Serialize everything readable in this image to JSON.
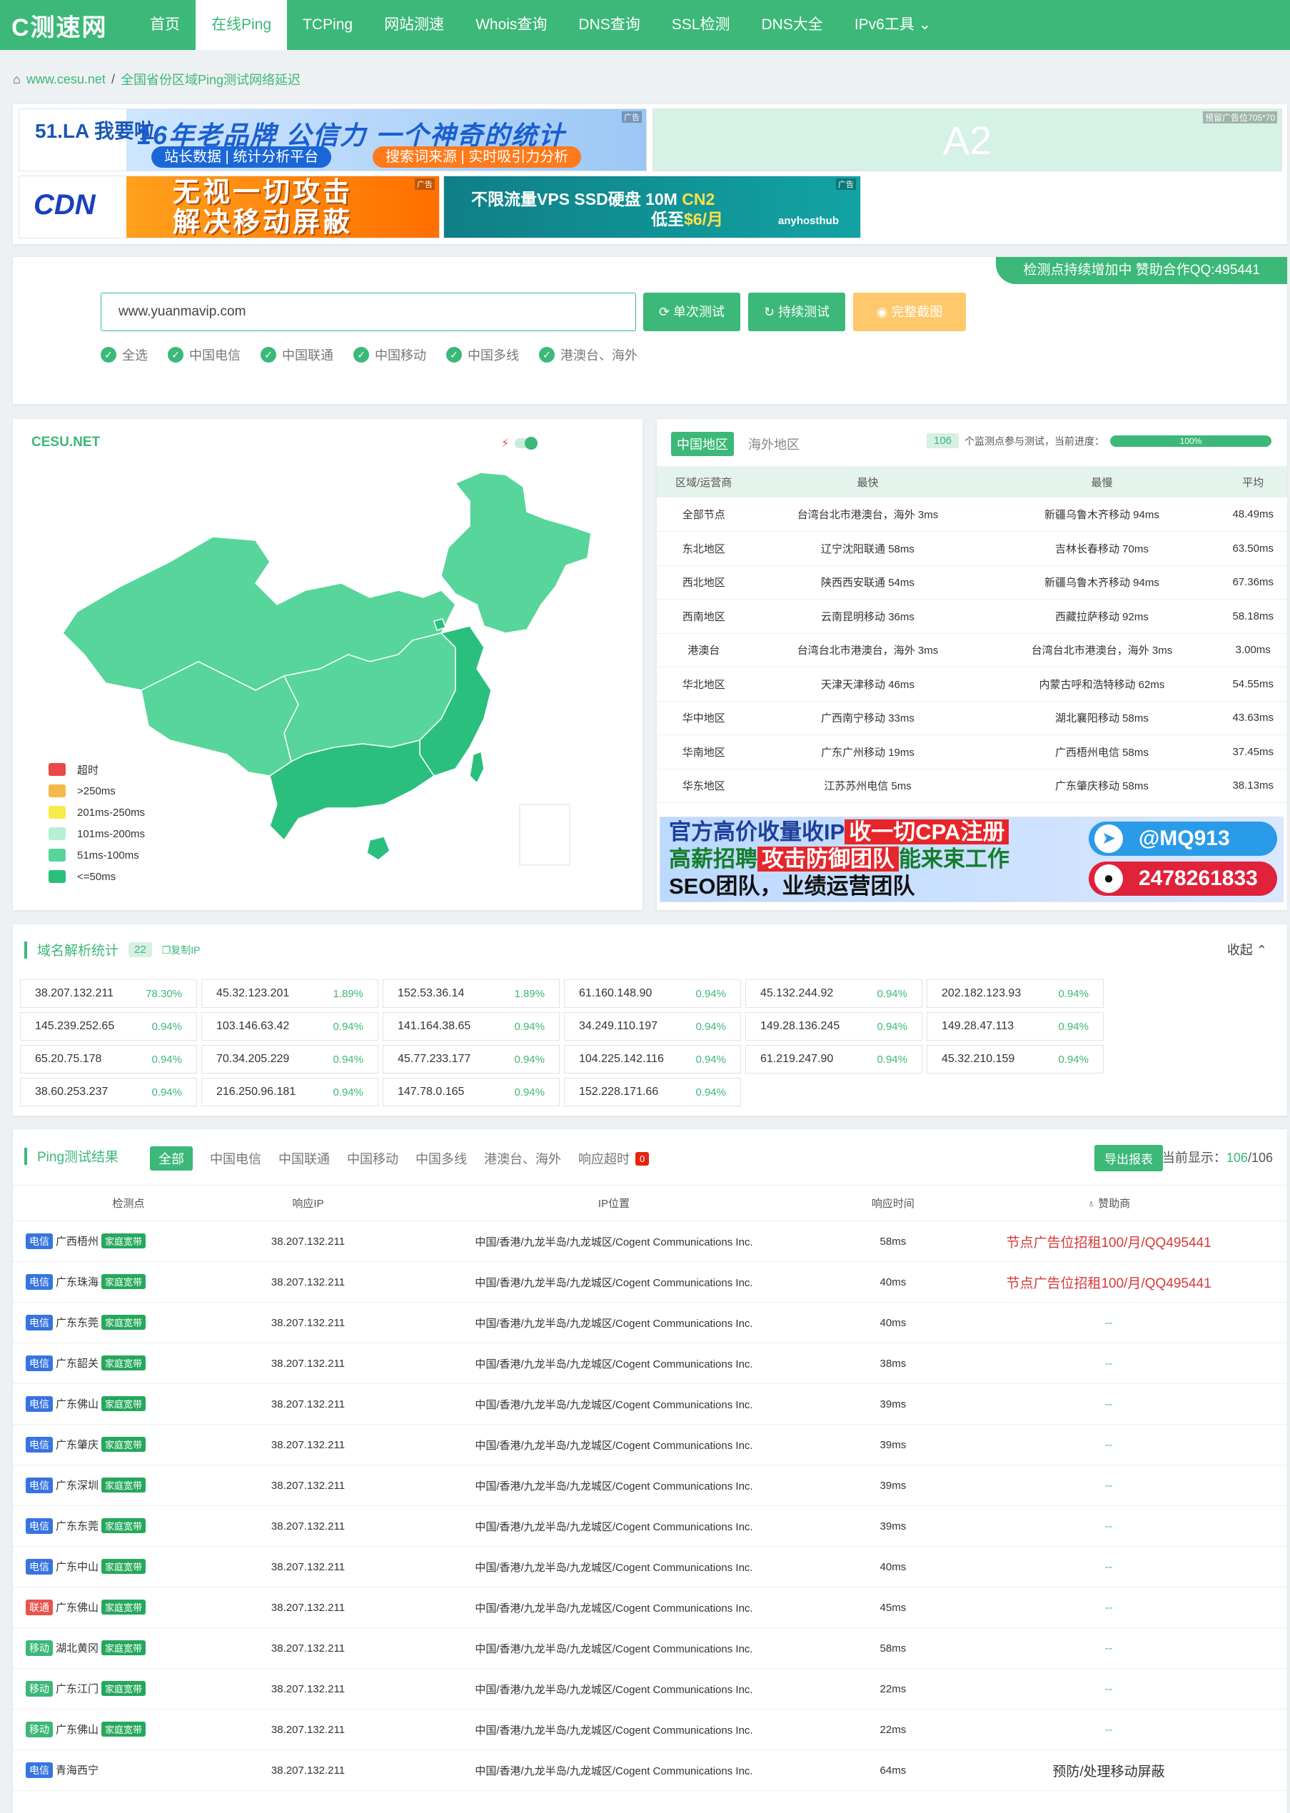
{
  "nav": {
    "logo": "C测速网",
    "items": [
      "首页",
      "在线Ping",
      "TCPing",
      "网站测速",
      "Whois查询",
      "DNS查询",
      "SSL检测",
      "DNS大全",
      "IPv6工具"
    ],
    "active": 1
  },
  "breadcrumb": {
    "home": "www.cesu.net",
    "sep": "/",
    "current": "全国省份区域Ping测试网络延迟"
  },
  "ads": {
    "b1_left": "51.LA 我要啦",
    "b1_title": "16年老品牌  公信力  一个神奇的统计",
    "b1_sub1": "站长数据 | 统计分析平台",
    "b1_sub2": "搜索词来源 | 实时吸引力分析",
    "tag": "广告",
    "b2_text": "A2",
    "b2_tag": "预留广告位705*70",
    "b3_logo": "CDN",
    "b3_line1": "无视一切攻击",
    "b3_line2": "解决移动屏蔽",
    "b4_line1a": "不限流量VPS SSD硬盘 10M ",
    "b4_line1b": "CN2",
    "b4_line2a": "低至",
    "b4_line2b": "$6/月",
    "b4_logo": "anyhosthub",
    "b5_line1a": "官方高价收量收IP",
    "b5_line1b": "收一切CPA注册",
    "b5_line2a": "高薪招聘",
    "b5_line2b": "攻击防御团队",
    "b5_line2c": "能来束工作",
    "b5_line3": "SEO团队，业绩运营团队",
    "b5_tg": "@MQ913",
    "b5_qq": "2478261833"
  },
  "search": {
    "promo": "检测点持续增加中 赞助合作QQ:495441",
    "value": "www.yuanmavip.com",
    "btn_single": "单次测试",
    "btn_continuous": "持续测试",
    "btn_screenshot": "完整截图",
    "filters": [
      "全选",
      "中国电信",
      "中国联通",
      "中国移动",
      "中国多线",
      "港澳台、海外"
    ]
  },
  "map": {
    "logo": "CESU.NET",
    "legend": [
      {
        "label": "超时",
        "color": "#e84848"
      },
      {
        "label": ">250ms",
        "color": "#f4b84b"
      },
      {
        "label": "201ms-250ms",
        "color": "#f6ec47"
      },
      {
        "label": "101ms-200ms",
        "color": "#b6f0d2"
      },
      {
        "label": "51ms-100ms",
        "color": "#57d59a"
      },
      {
        "label": "<=50ms",
        "color": "#2bbf7e"
      }
    ]
  },
  "stats": {
    "tabs": [
      "中国地区",
      "海外地区"
    ],
    "count": "106",
    "progress_text": "个监测点参与测试，当前进度：",
    "progress_label": "100%",
    "progress_value": 100,
    "headers": [
      "区域/运营商",
      "最快",
      "最慢",
      "平均"
    ],
    "rows": [
      [
        "全部节点",
        "台湾台北市港澳台，海外 3ms",
        "新疆乌鲁木齐移动 94ms",
        "48.49ms"
      ],
      [
        "东北地区",
        "辽宁沈阳联通 58ms",
        "吉林长春移动 70ms",
        "63.50ms"
      ],
      [
        "西北地区",
        "陕西西安联通 54ms",
        "新疆乌鲁木齐移动 94ms",
        "67.36ms"
      ],
      [
        "西南地区",
        "云南昆明移动 36ms",
        "西藏拉萨移动 92ms",
        "58.18ms"
      ],
      [
        "港澳台",
        "台湾台北市港澳台，海外 3ms",
        "台湾台北市港澳台，海外 3ms",
        "3.00ms"
      ],
      [
        "华北地区",
        "天津天津移动 46ms",
        "内蒙古呼和浩特移动 62ms",
        "54.55ms"
      ],
      [
        "华中地区",
        "广西南宁移动 33ms",
        "湖北襄阳移动 58ms",
        "43.63ms"
      ],
      [
        "华南地区",
        "广东广州移动 19ms",
        "广西梧州电信 58ms",
        "37.45ms"
      ],
      [
        "华东地区",
        "江苏苏州电信 5ms",
        "广东肇庆移动 58ms",
        "38.13ms"
      ]
    ]
  },
  "dns": {
    "title": "域名解析统计",
    "count": "22",
    "copy": "复制IP",
    "collapse": "收起",
    "ips": [
      [
        "38.207.132.211",
        "78.30%"
      ],
      [
        "45.32.123.201",
        "1.89%"
      ],
      [
        "152.53.36.14",
        "1.89%"
      ],
      [
        "61.160.148.90",
        "0.94%"
      ],
      [
        "45.132.244.92",
        "0.94%"
      ],
      [
        "202.182.123.93",
        "0.94%"
      ],
      [
        "145.239.252.65",
        "0.94%"
      ],
      [
        "103.146.63.42",
        "0.94%"
      ],
      [
        "141.164.38.65",
        "0.94%"
      ],
      [
        "34.249.110.197",
        "0.94%"
      ],
      [
        "149.28.136.245",
        "0.94%"
      ],
      [
        "149.28.47.113",
        "0.94%"
      ],
      [
        "65.20.75.178",
        "0.94%"
      ],
      [
        "70.34.205.229",
        "0.94%"
      ],
      [
        "45.77.233.177",
        "0.94%"
      ],
      [
        "104.225.142.116",
        "0.94%"
      ],
      [
        "61.219.247.90",
        "0.94%"
      ],
      [
        "45.32.210.159",
        "0.94%"
      ],
      [
        "38.60.253.237",
        "0.94%"
      ],
      [
        "216.250.96.181",
        "0.94%"
      ],
      [
        "147.78.0.165",
        "0.94%"
      ],
      [
        "152.228.171.66",
        "0.94%"
      ]
    ]
  },
  "results": {
    "title": "Ping测试结果",
    "tabs": [
      "全部",
      "中国电信",
      "中国联通",
      "中国移动",
      "中国多线",
      "港澳台、海外",
      "响应超时"
    ],
    "timeout_count": "0",
    "export": "导出报表",
    "current_label": "当前显示：",
    "current_shown": "106",
    "current_total": "/106",
    "headers": [
      "检测点",
      "响应IP",
      "IP位置",
      "响应时间",
      "赞助商"
    ],
    "rows": [
      {
        "isp": "电信",
        "cls": "dx",
        "site": "广西梧州",
        "tag": "家庭宽带",
        "ip": "38.207.132.211",
        "loc": "中国/香港/九龙半岛/九龙城区/Cogent Communications Inc.",
        "time": "58ms",
        "sponsor": "节点广告位招租100/月/QQ495441",
        "st": "red"
      },
      {
        "isp": "电信",
        "cls": "dx",
        "site": "广东珠海",
        "tag": "家庭宽带",
        "ip": "38.207.132.211",
        "loc": "中国/香港/九龙半岛/九龙城区/Cogent Communications Inc.",
        "time": "40ms",
        "sponsor": "节点广告位招租100/月/QQ495441",
        "st": "red"
      },
      {
        "isp": "电信",
        "cls": "dx",
        "site": "广东东莞",
        "tag": "家庭宽带",
        "ip": "38.207.132.211",
        "loc": "中国/香港/九龙半岛/九龙城区/Cogent Communications Inc.",
        "time": "40ms",
        "sponsor": "--",
        "st": "dash"
      },
      {
        "isp": "电信",
        "cls": "dx",
        "site": "广东韶关",
        "tag": "家庭宽带",
        "ip": "38.207.132.211",
        "loc": "中国/香港/九龙半岛/九龙城区/Cogent Communications Inc.",
        "time": "38ms",
        "sponsor": "--",
        "st": "dash"
      },
      {
        "isp": "电信",
        "cls": "dx",
        "site": "广东佛山",
        "tag": "家庭宽带",
        "ip": "38.207.132.211",
        "loc": "中国/香港/九龙半岛/九龙城区/Cogent Communications Inc.",
        "time": "39ms",
        "sponsor": "--",
        "st": "dash"
      },
      {
        "isp": "电信",
        "cls": "dx",
        "site": "广东肇庆",
        "tag": "家庭宽带",
        "ip": "38.207.132.211",
        "loc": "中国/香港/九龙半岛/九龙城区/Cogent Communications Inc.",
        "time": "39ms",
        "sponsor": "--",
        "st": "dash"
      },
      {
        "isp": "电信",
        "cls": "dx",
        "site": "广东深圳",
        "tag": "家庭宽带",
        "ip": "38.207.132.211",
        "loc": "中国/香港/九龙半岛/九龙城区/Cogent Communications Inc.",
        "time": "39ms",
        "sponsor": "--",
        "st": "dash"
      },
      {
        "isp": "电信",
        "cls": "dx",
        "site": "广东东莞",
        "tag": "家庭宽带",
        "ip": "38.207.132.211",
        "loc": "中国/香港/九龙半岛/九龙城区/Cogent Communications Inc.",
        "time": "39ms",
        "sponsor": "--",
        "st": "dash"
      },
      {
        "isp": "电信",
        "cls": "dx",
        "site": "广东中山",
        "tag": "家庭宽带",
        "ip": "38.207.132.211",
        "loc": "中国/香港/九龙半岛/九龙城区/Cogent Communications Inc.",
        "time": "40ms",
        "sponsor": "--",
        "st": "dash"
      },
      {
        "isp": "联通",
        "cls": "lt",
        "site": "广东佛山",
        "tag": "家庭宽带",
        "ip": "38.207.132.211",
        "loc": "中国/香港/九龙半岛/九龙城区/Cogent Communications Inc.",
        "time": "45ms",
        "sponsor": "--",
        "st": "dash"
      },
      {
        "isp": "移动",
        "cls": "yd",
        "site": "湖北黄冈",
        "tag": "家庭宽带",
        "ip": "38.207.132.211",
        "loc": "中国/香港/九龙半岛/九龙城区/Cogent Communications Inc.",
        "time": "58ms",
        "sponsor": "--",
        "st": "dash"
      },
      {
        "isp": "移动",
        "cls": "yd",
        "site": "广东江门",
        "tag": "家庭宽带",
        "ip": "38.207.132.211",
        "loc": "中国/香港/九龙半岛/九龙城区/Cogent Communications Inc.",
        "time": "22ms",
        "sponsor": "--",
        "st": "dash"
      },
      {
        "isp": "移动",
        "cls": "yd",
        "site": "广东佛山",
        "tag": "家庭宽带",
        "ip": "38.207.132.211",
        "loc": "中国/香港/九龙半岛/九龙城区/Cogent Communications Inc.",
        "time": "22ms",
        "sponsor": "--",
        "st": "dash"
      },
      {
        "isp": "电信",
        "cls": "dx",
        "site": "青海西宁",
        "tag": "",
        "ip": "38.207.132.211",
        "loc": "中国/香港/九龙半岛/九龙城区/Cogent Communications Inc.",
        "time": "64ms",
        "sponsor": "预防/处理移动屏蔽",
        "st": "dark"
      }
    ]
  }
}
